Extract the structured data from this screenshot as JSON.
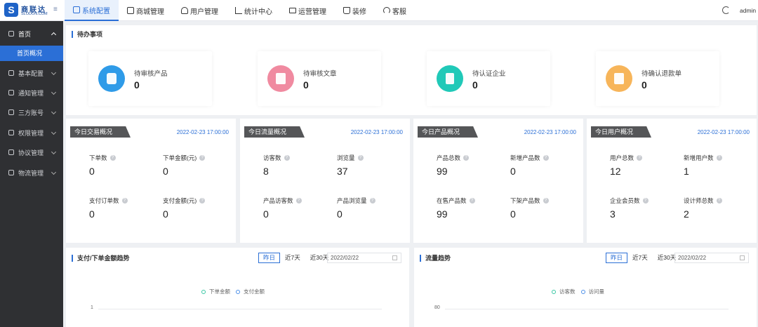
{
  "brand": {
    "mark": "S",
    "name": "商联达",
    "sub": "SLODON.COM"
  },
  "nav": [
    {
      "label": "系统配置",
      "active": true
    },
    {
      "label": "商城管理",
      "active": false
    },
    {
      "label": "用户管理",
      "active": false
    },
    {
      "label": "统计中心",
      "active": false
    },
    {
      "label": "运营管理",
      "active": false
    },
    {
      "label": "装修",
      "active": false
    },
    {
      "label": "客服",
      "active": false
    }
  ],
  "user": {
    "name": "admin"
  },
  "sidebar": {
    "home": "首页",
    "home_sub": "首页概况",
    "items": [
      "基本配置",
      "通知管理",
      "三方账号",
      "权限管理",
      "协议管理",
      "物流管理"
    ]
  },
  "todo": {
    "title": "待办事项",
    "cards": [
      {
        "label": "待审核产品",
        "value": "0",
        "color": "#2f9be8",
        "icon": "cube-icon"
      },
      {
        "label": "待审核文章",
        "value": "0",
        "color": "#f08aa0",
        "icon": "document-icon"
      },
      {
        "label": "待认证企业",
        "value": "0",
        "color": "#20c9b8",
        "icon": "building-icon"
      },
      {
        "label": "待确认退款单",
        "value": "0",
        "color": "#f7b55a",
        "icon": "refund-icon"
      }
    ]
  },
  "stats": [
    {
      "title": "今日交易概况",
      "date": "2022-02-23 17:00:00",
      "metrics": [
        {
          "label": "下单数",
          "value": "0"
        },
        {
          "label": "下单金额(元)",
          "value": "0"
        },
        {
          "label": "支付订单数",
          "value": "0"
        },
        {
          "label": "支付金额(元)",
          "value": "0"
        }
      ]
    },
    {
      "title": "今日流量概况",
      "date": "2022-02-23 17:00:00",
      "metrics": [
        {
          "label": "访客数",
          "value": "8"
        },
        {
          "label": "浏览量",
          "value": "37"
        },
        {
          "label": "产品访客数",
          "value": "0"
        },
        {
          "label": "产品浏览量",
          "value": "0"
        }
      ]
    },
    {
      "title": "今日产品概况",
      "date": "2022-02-23 17:00:00",
      "metrics": [
        {
          "label": "产品总数",
          "value": "99"
        },
        {
          "label": "新增产品数",
          "value": "0"
        },
        {
          "label": "在售产品数",
          "value": "99"
        },
        {
          "label": "下架产品数",
          "value": "0"
        }
      ]
    },
    {
      "title": "今日用户概况",
      "date": "2022-02-23 17:00:00",
      "metrics": [
        {
          "label": "用户总数",
          "value": "12"
        },
        {
          "label": "新增用户数",
          "value": "1"
        },
        {
          "label": "企业会员数",
          "value": "3"
        },
        {
          "label": "设计师总数",
          "value": "2"
        }
      ]
    }
  ],
  "trends": [
    {
      "title": "支付/下单金额趋势",
      "ranges": [
        "昨日",
        "近7天",
        "近30天"
      ],
      "date": "2022/02/22",
      "legend": [
        {
          "name": "下单金额",
          "color": "#39c7a4"
        },
        {
          "name": "支付金额",
          "color": "#4c8fe8"
        }
      ],
      "y_top": "1"
    },
    {
      "title": "流量趋势",
      "ranges": [
        "昨日",
        "近7天",
        "近30天"
      ],
      "date": "2022/02/22",
      "legend": [
        {
          "name": "访客数",
          "color": "#39c7a4"
        },
        {
          "name": "访问量",
          "color": "#4c8fe8"
        }
      ],
      "y_top": "80"
    }
  ]
}
